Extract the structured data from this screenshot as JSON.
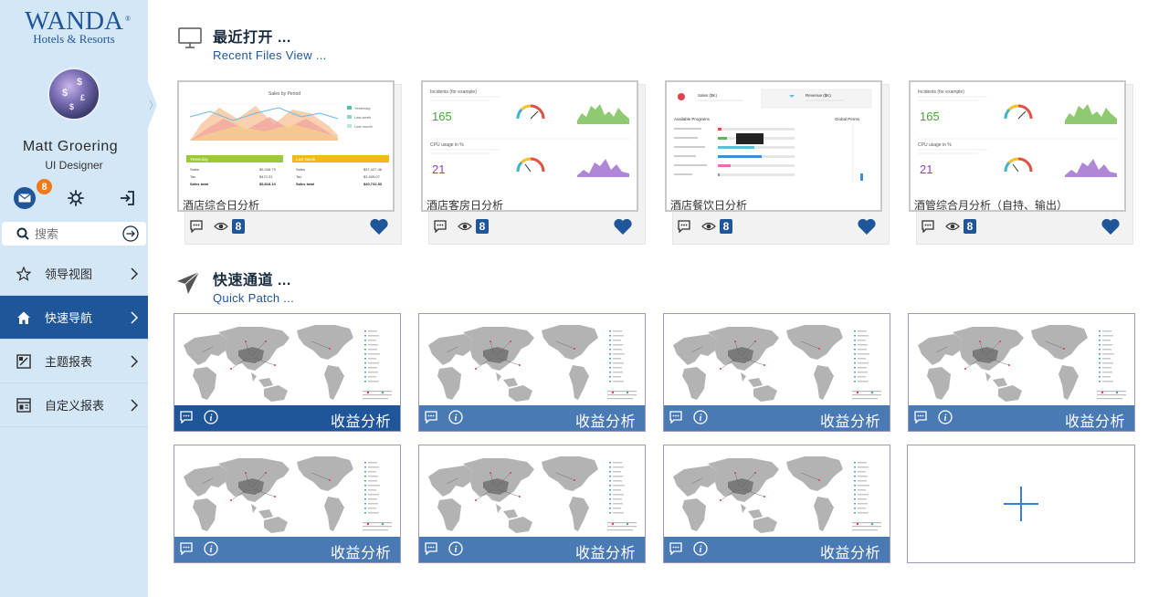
{
  "brand": {
    "name": "WANDA",
    "reg": "®",
    "subtitle": "Hotels & Resorts"
  },
  "user": {
    "name": "Matt Groering",
    "role": "UI Designer",
    "unread_messages": "8"
  },
  "search": {
    "placeholder": "搜索"
  },
  "nav": {
    "items": [
      {
        "label": "领导视图",
        "icon": "star-icon",
        "active": false
      },
      {
        "label": "快速导航",
        "icon": "home-icon",
        "active": true
      },
      {
        "label": "主题报表",
        "icon": "report-icon",
        "active": false
      },
      {
        "label": "自定义报表",
        "icon": "custom-report-icon",
        "active": false
      }
    ]
  },
  "recent": {
    "title": "最近打开 ...",
    "subtitle": "Recent  Files  View ...",
    "cards": [
      {
        "title": "酒店综合日分析",
        "views": "8",
        "thumb": "area-chart"
      },
      {
        "title": "酒店客房日分析",
        "views": "8",
        "thumb": "cpu-dashboard"
      },
      {
        "title": "酒店餐饮日分析",
        "views": "8",
        "thumb": "bar-dashboard"
      },
      {
        "title": "酒管综合月分析（自持、输出）",
        "views": "8",
        "thumb": "cpu-dashboard"
      }
    ]
  },
  "quick": {
    "title": "快速通道 ...",
    "subtitle": "Quick  Patch ...",
    "cards": [
      {
        "label": "收益分析"
      },
      {
        "label": "收益分析"
      },
      {
        "label": "收益分析"
      },
      {
        "label": "收益分析"
      },
      {
        "label": "收益分析"
      },
      {
        "label": "收益分析"
      },
      {
        "label": "收益分析"
      }
    ],
    "add_label": "+"
  },
  "thumbnails": {
    "area_chart": {
      "title": "Sales by Period",
      "legend": [
        "Yesterday",
        "Last week",
        "Last month"
      ],
      "panel_left": {
        "header": "Yesterday",
        "rows": [
          [
            "Sales",
            "$5,346.79"
          ],
          [
            "Tax",
            "$472.31"
          ],
          [
            "Sales total",
            "$5,818.10"
          ]
        ]
      },
      "panel_right": {
        "header": "Last Week",
        "rows": [
          [
            "Sales",
            "$37,427.46"
          ],
          [
            "Tax",
            "$3,305.07"
          ],
          [
            "Sales total",
            "$40,732.53"
          ]
        ]
      }
    },
    "cpu_dashboard": {
      "top_title": "Incidents (for example)",
      "top_value": "165",
      "bottom_title": "CPU usage in %",
      "bottom_value": "21"
    },
    "bar_dashboard": {
      "card1_title": "Sales ($K)",
      "card2_title": "Revenue ($K)",
      "list_title": "Available Programs",
      "side_title": "Global Perms"
    }
  },
  "colors": {
    "brand_blue": "#1f5599",
    "bar_blue": "#4a7ab4",
    "sidebar_bg": "#d4e7f7",
    "badge_orange": "#f07a1a",
    "map_land": "#b3b3b3",
    "map_china": "#7a7a7a"
  }
}
